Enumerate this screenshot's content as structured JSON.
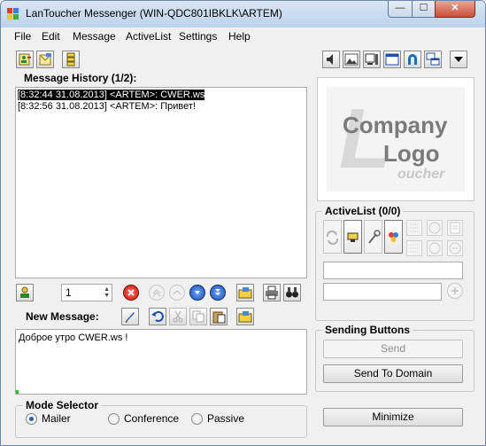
{
  "window": {
    "title": "LanToucher Messenger (WIN-QDC801IBKLK\\ARTEM)",
    "min_glyph": "—",
    "max_glyph": "☐",
    "close_glyph": "✕"
  },
  "menu": [
    "File",
    "Edit",
    "Message",
    "ActiveList",
    "Settings",
    "Help"
  ],
  "history": {
    "label": "Message History (1/2):",
    "lines": [
      "[8:32:44 31.08.2013] <ARTEM>: CWER.ws",
      "[8:32:56 31.08.2013] <ARTEM>: Привет!"
    ]
  },
  "history_toolbar": {
    "spin_value": "1"
  },
  "new_message": {
    "label": "New Message:",
    "text": "Доброе утро CWER.ws !"
  },
  "mode_selector": {
    "title": "Mode Selector",
    "options": [
      "Mailer",
      "Conference",
      "Passive"
    ],
    "selected": "Mailer"
  },
  "logo": {
    "line1": "Company",
    "line2": "Logo",
    "line3": "oucher",
    "mark": "L"
  },
  "activelist": {
    "title": "ActiveList (0/0)"
  },
  "sending": {
    "title": "Sending Buttons",
    "send_label": "Send",
    "send_domain_label": "Send To Domain"
  },
  "minimize_label": "Minimize",
  "colors": {
    "title_bar": "#c4d7ec",
    "close_button": "#c8503a",
    "selected_line_bg": "#000000",
    "radio_dot": "#1a5fb4"
  },
  "icons": {
    "top_left": [
      "contacts-add-icon",
      "compose-icon",
      "list-icon"
    ],
    "top_right": [
      "speaker-icon",
      "picture-icon",
      "monitor-icon",
      "window-icon",
      "magnet-icon",
      "windows-cascade-icon",
      "dropdown-arrow-icon"
    ]
  }
}
